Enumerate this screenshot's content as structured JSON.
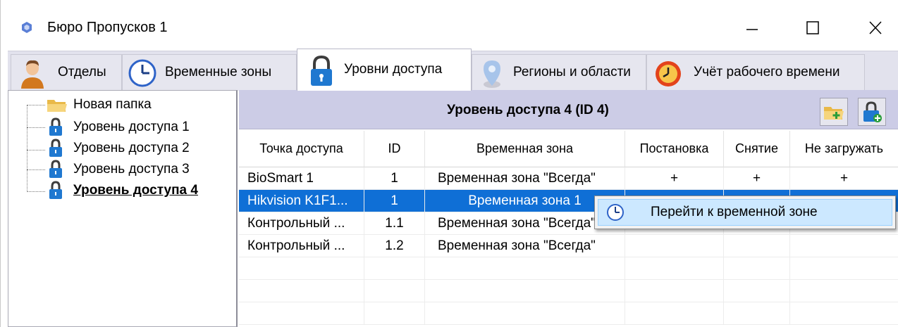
{
  "window": {
    "title": "Бюро Пропусков 1"
  },
  "tabs": [
    {
      "label": "Отделы",
      "icon": "person-icon"
    },
    {
      "label": "Временные зоны",
      "icon": "clock-icon"
    },
    {
      "label": "Уровни доступа",
      "icon": "padlock-icon",
      "active": true
    },
    {
      "label": "Регионы и области",
      "icon": "map-pin-icon"
    },
    {
      "label": "Учёт рабочего времени",
      "icon": "alarm-clock-icon"
    }
  ],
  "tree": {
    "items": [
      {
        "label": "Новая папка",
        "icon": "folder-icon"
      },
      {
        "label": "Уровень доступа 1",
        "icon": "lock-icon"
      },
      {
        "label": "Уровень доступа 2",
        "icon": "lock-icon"
      },
      {
        "label": "Уровень доступа 3",
        "icon": "lock-icon"
      },
      {
        "label": "Уровень доступа 4",
        "icon": "lock-icon",
        "selected": true
      }
    ]
  },
  "panel": {
    "title": "Уровень доступа 4 (ID 4)",
    "buttons": [
      "add-folder-icon",
      "add-lock-icon"
    ]
  },
  "grid": {
    "columns": [
      "Точка доступа",
      "ID",
      "Временная зона",
      "Постановка",
      "Снятие",
      "Не загружать"
    ],
    "rows": [
      [
        "BioSmart 1",
        "1",
        "Временная зона \"Всегда\"",
        "+",
        "+",
        "+"
      ],
      [
        "Hikvision K1F1...",
        "1",
        "Временная зона 1",
        "",
        "",
        ""
      ],
      [
        "Контрольный ...",
        "1.1",
        "Временная зона \"Всегда\"",
        "",
        "",
        ""
      ],
      [
        "Контрольный ...",
        "1.2",
        "Временная зона \"Всегда\"",
        "",
        "",
        ""
      ]
    ],
    "selected_row": 1
  },
  "context_menu": {
    "items": [
      {
        "label": "Перейти к временной зоне",
        "icon": "clock-icon"
      }
    ]
  },
  "colors": {
    "selection": "#0f6fd6",
    "tab_strip": "#e2e2ed",
    "panel_header": "#cccce6",
    "menu_highlight": "#cce8ff"
  }
}
